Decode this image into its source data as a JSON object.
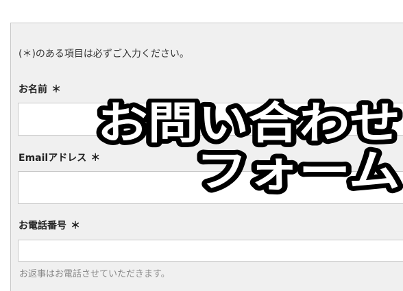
{
  "form": {
    "note": "(＊)のある項目は必ずご入力ください。",
    "fields": [
      {
        "label": "お名前",
        "required_mark": "＊",
        "value": "",
        "placeholder": ""
      },
      {
        "label": "Emailアドレス",
        "required_mark": "＊",
        "value": "",
        "placeholder": ""
      },
      {
        "label": "お電話番号",
        "required_mark": "＊",
        "value": "",
        "placeholder": ""
      }
    ],
    "phone_hint": "お返事はお電話させていただきます。"
  },
  "overlay": {
    "line1": "お問い合わせ",
    "line2": "フォーム",
    "fill_color": "#ffffff",
    "stroke_color": "#000000"
  },
  "colors": {
    "panel_background": "#f0f0f0",
    "field_border": "#c8c8c8",
    "hint_text": "#8a8a8a"
  }
}
